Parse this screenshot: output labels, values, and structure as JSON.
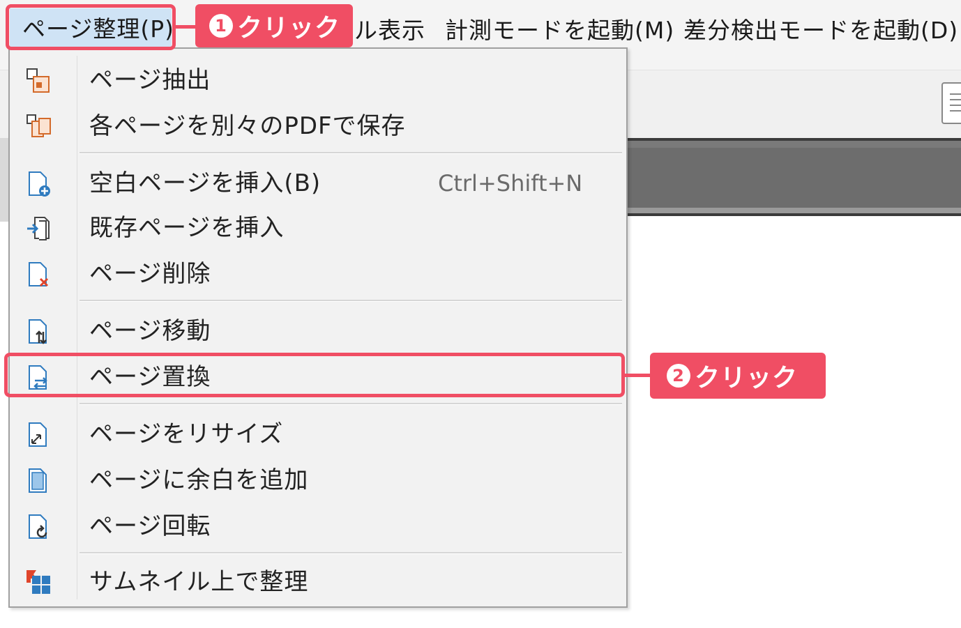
{
  "menubar": {
    "items": [
      {
        "label": "ページ整理(P)",
        "active": true
      },
      {
        "label": "ル表示"
      },
      {
        "label": "計測モードを起動(M)"
      },
      {
        "label": "差分検出モードを起動(D)"
      }
    ]
  },
  "dropdown": {
    "items": [
      {
        "label": "ページ抽出",
        "icon": "page-extract-icon"
      },
      {
        "label": "各ページを別々のPDFで保存",
        "icon": "save-pages-separately-icon"
      },
      {
        "label": "空白ページを挿入(B)",
        "shortcut": "Ctrl+Shift+N",
        "icon": "insert-blank-page-icon"
      },
      {
        "label": "既存ページを挿入",
        "icon": "insert-existing-page-icon"
      },
      {
        "label": "ページ削除",
        "icon": "delete-page-icon"
      },
      {
        "label": "ページ移動",
        "icon": "move-page-icon"
      },
      {
        "label": "ページ置換",
        "icon": "replace-page-icon"
      },
      {
        "label": "ページをリサイズ",
        "icon": "resize-page-icon"
      },
      {
        "label": "ページに余白を追加",
        "icon": "add-margin-icon"
      },
      {
        "label": "ページ回転",
        "icon": "rotate-page-icon"
      },
      {
        "label": "サムネイル上で整理",
        "icon": "thumbnail-organize-icon"
      }
    ]
  },
  "callouts": {
    "step1": {
      "number": "1",
      "text": "クリック"
    },
    "step2": {
      "number": "2",
      "text": "クリック"
    }
  },
  "colors": {
    "highlight": "#f04e64",
    "menu_active_bg": "#cfe3f5",
    "icon_blue": "#2f7bbf",
    "icon_orange": "#e06a2b"
  }
}
